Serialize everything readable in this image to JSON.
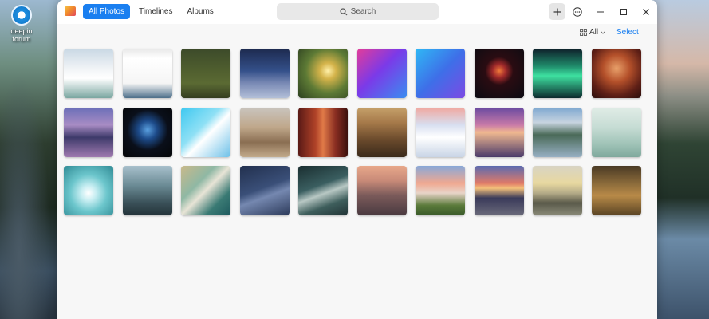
{
  "desktop": {
    "icon_label": "deepin forum"
  },
  "window": {
    "tabs": [
      {
        "label": "All Photos",
        "active": true
      },
      {
        "label": "Timelines",
        "active": false
      },
      {
        "label": "Albums",
        "active": false
      }
    ],
    "search_placeholder": "Search",
    "view_filter_label": "All",
    "select_label": "Select",
    "accent_color": "#1a7ff0"
  },
  "photos": [
    {
      "row": 1,
      "col": 1,
      "icon": "screenshot-thumb",
      "fill": "linear-gradient(180deg,#c9d8e4 0%,#f0f3f6 40%,#ffffff 60%,#7aa6a0 100%)"
    },
    {
      "row": 1,
      "col": 2,
      "icon": "screenshot-thumb",
      "fill": "linear-gradient(180deg,#e8e8e8 0%,#ffffff 20%,#f5f5f5 70%,#4e6f8a 100%)"
    },
    {
      "row": 1,
      "col": 3,
      "icon": "screenshot-thumb",
      "fill": "linear-gradient(180deg,#3c4a2a 0%,#4e5d2e 40%,#5b6a33 70%,#343d20 100%)"
    },
    {
      "row": 1,
      "col": 4,
      "icon": "photo-thumb",
      "fill": "linear-gradient(180deg,#1d2a4f 0%,#34508a 45%,#7a8ab5 70%,#b3bfd8 100%)"
    },
    {
      "row": 1,
      "col": 5,
      "icon": "photo-thumb",
      "fill": "radial-gradient(circle at 60% 45%,#fff0a8 0%,#d4b34a 20%,#5d7a35 55%,#2d4020 100%)"
    },
    {
      "row": 1,
      "col": 6,
      "icon": "photo-thumb",
      "fill": "linear-gradient(135deg,#e23c9a 0%,#7b3ae8 45%,#3a8df0 100%)"
    },
    {
      "row": 1,
      "col": 7,
      "icon": "photo-thumb",
      "fill": "linear-gradient(135deg,#2fb8f5 0%,#3e6fe8 50%,#7c4ae4 100%)"
    },
    {
      "row": 1,
      "col": 8,
      "icon": "photo-thumb",
      "fill": "radial-gradient(circle at 50% 45%,#f07a3a 0%,#a0292a 18%,#2a0c12 38%,#0b0b12 100%)"
    },
    {
      "row": 1,
      "col": 9,
      "icon": "photo-thumb",
      "fill": "linear-gradient(180deg,#0e1f2a 0%,#1f8a6a 35%,#3ee0a0 55%,#0c2a2e 100%)"
    },
    {
      "row": 1,
      "col": 10,
      "icon": "photo-thumb",
      "fill": "radial-gradient(circle at 50% 40%,#e8a06a 0%,#b4502a 35%,#5e1f16 70%,#2a0e0c 100%)"
    },
    {
      "row": 2,
      "col": 1,
      "icon": "photo-thumb",
      "fill": "linear-gradient(180deg,#6b6fb8 0%,#a88cc4 35%,#3d3a6a 60%,#a07ab0 100%)"
    },
    {
      "row": 2,
      "col": 2,
      "icon": "photo-thumb",
      "fill": "radial-gradient(circle at 50% 45%,#5aa0e0 0%,#1d4b8a 25%,#0a0f1a 55%,#050608 100%)"
    },
    {
      "row": 2,
      "col": 3,
      "icon": "photo-thumb",
      "fill": "linear-gradient(135deg,#3ec8f0 0%,#8fe0f5 40%,#ffffff 55%,#6cc0e8 100%)"
    },
    {
      "row": 2,
      "col": 4,
      "icon": "photo-thumb",
      "fill": "linear-gradient(180deg,#c9c4bd 0%,#bfa78a 40%,#8a6e52 70%,#c3ab8c 100%)"
    },
    {
      "row": 2,
      "col": 5,
      "icon": "photo-thumb",
      "fill": "linear-gradient(90deg,#5a1a16 0%,#b04228 35%,#e07a48 50%,#8a2e22 75%,#3c100c 100%)"
    },
    {
      "row": 2,
      "col": 6,
      "icon": "photo-thumb",
      "fill": "linear-gradient(180deg,#c5a06a 0%,#a67a4a 30%,#6a4a2c 65%,#3a2a1a 100%)"
    },
    {
      "row": 2,
      "col": 7,
      "icon": "photo-thumb",
      "fill": "linear-gradient(180deg,#f0a8a0 0%,#d8dff0 35%,#ffffff 60%,#c8d4e6 100%)"
    },
    {
      "row": 2,
      "col": 8,
      "icon": "photo-thumb",
      "fill": "linear-gradient(180deg,#6a4aa0 0%,#c87aa8 35%,#f0b890 50%,#4a3a6a 100%)"
    },
    {
      "row": 2,
      "col": 9,
      "icon": "photo-thumb",
      "fill": "linear-gradient(180deg,#7fa8d0 0%,#c7d4e0 30%,#4a6a58 55%,#98b0c4 100%)"
    },
    {
      "row": 2,
      "col": 10,
      "icon": "photo-thumb",
      "fill": "linear-gradient(180deg,#e0ece6 0%,#c6dcd4 40%,#9ec2b6 75%,#7fa89c 100%)"
    },
    {
      "row": 3,
      "col": 1,
      "icon": "photo-thumb",
      "fill": "radial-gradient(circle at 50% 55%,#ffffff 0%,#c8eef2 20%,#6cc6cc 50%,#2f8a94 100%)"
    },
    {
      "row": 3,
      "col": 2,
      "icon": "photo-thumb",
      "fill": "linear-gradient(180deg,#a8c0cc 0%,#6a8a94 40%,#3a5058 75%,#24343a 100%)"
    },
    {
      "row": 3,
      "col": 3,
      "icon": "photo-thumb",
      "fill": "linear-gradient(135deg,#c9b98a 0%,#8fb8a4 35%,#e8e4d6 50%,#3a7a74 75%,#1e5a5e 100%)"
    },
    {
      "row": 3,
      "col": 4,
      "icon": "photo-thumb",
      "fill": "linear-gradient(160deg,#22304e 0%,#3a4f78 45%,#7588b0 60%,#2c3a5a 100%)"
    },
    {
      "row": 3,
      "col": 5,
      "icon": "photo-thumb",
      "fill": "linear-gradient(160deg,#1a2e30 0%,#3a5e60 40%,#b8c8c4 55%,#3e5e5c 75%,#223436 100%)"
    },
    {
      "row": 3,
      "col": 6,
      "icon": "photo-thumb",
      "fill": "linear-gradient(180deg,#e8a88a 0%,#c88a78 30%,#7a5a5a 60%,#4a3a40 100%)"
    },
    {
      "row": 3,
      "col": 7,
      "icon": "photo-thumb",
      "fill": "linear-gradient(180deg,#88a8d8 0%,#f0a890 35%,#e8d4c8 55%,#5a7a3a 80%,#3a5a2a 100%)"
    },
    {
      "row": 3,
      "col": 8,
      "icon": "photo-thumb",
      "fill": "linear-gradient(180deg,#5a6ab0 0%,#e07a68 35%,#f4c07a 45%,#3a3a5a 65%,#6a6a7a 100%)"
    },
    {
      "row": 3,
      "col": 9,
      "icon": "photo-thumb",
      "fill": "linear-gradient(180deg,#d8d4c4 0%,#e8d8a0 35%,#b4ab88 55%,#5a5a4a 75%,#8a8a78 100%)"
    },
    {
      "row": 3,
      "col": 10,
      "icon": "photo-thumb",
      "fill": "linear-gradient(180deg,#4a3a24 0%,#8a6a3a 35%,#b88a48 60%,#5a4424 100%)"
    }
  ]
}
